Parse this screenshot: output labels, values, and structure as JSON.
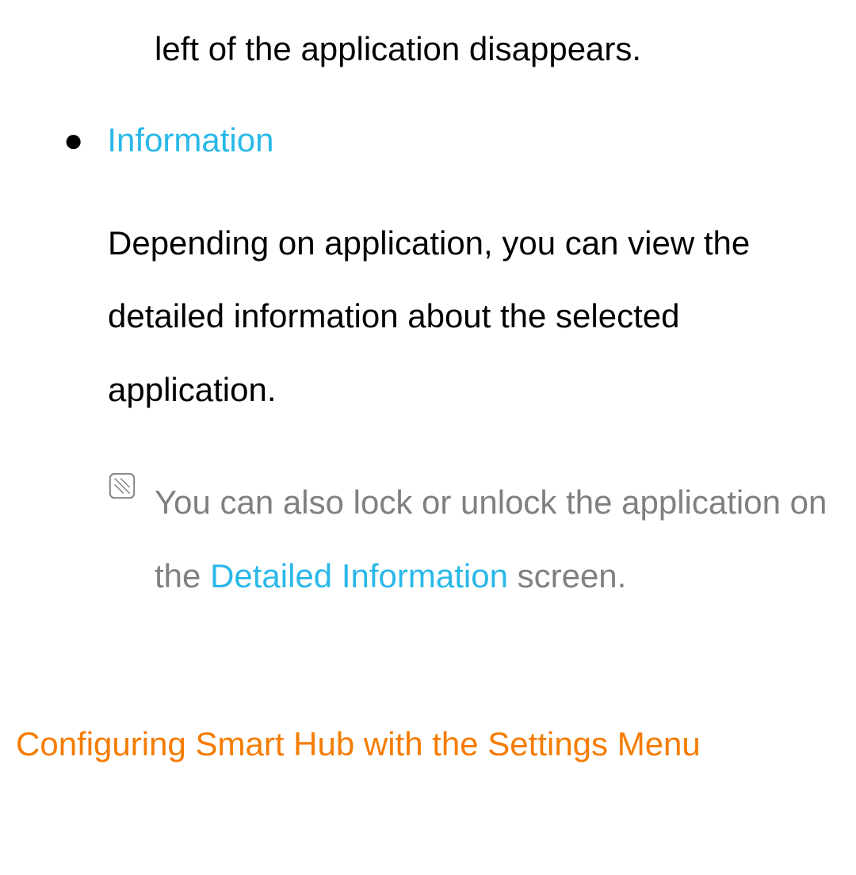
{
  "fragment": "left of the application disappears.",
  "bullet": {
    "title": "Information",
    "body": "Depending on application, you can view the detailed information about the selected application."
  },
  "note": {
    "text_before": "You can also lock or unlock the application on the ",
    "highlight": "Detailed Information",
    "text_after": " screen."
  },
  "section_heading": "Configuring Smart Hub with the Settings Menu"
}
